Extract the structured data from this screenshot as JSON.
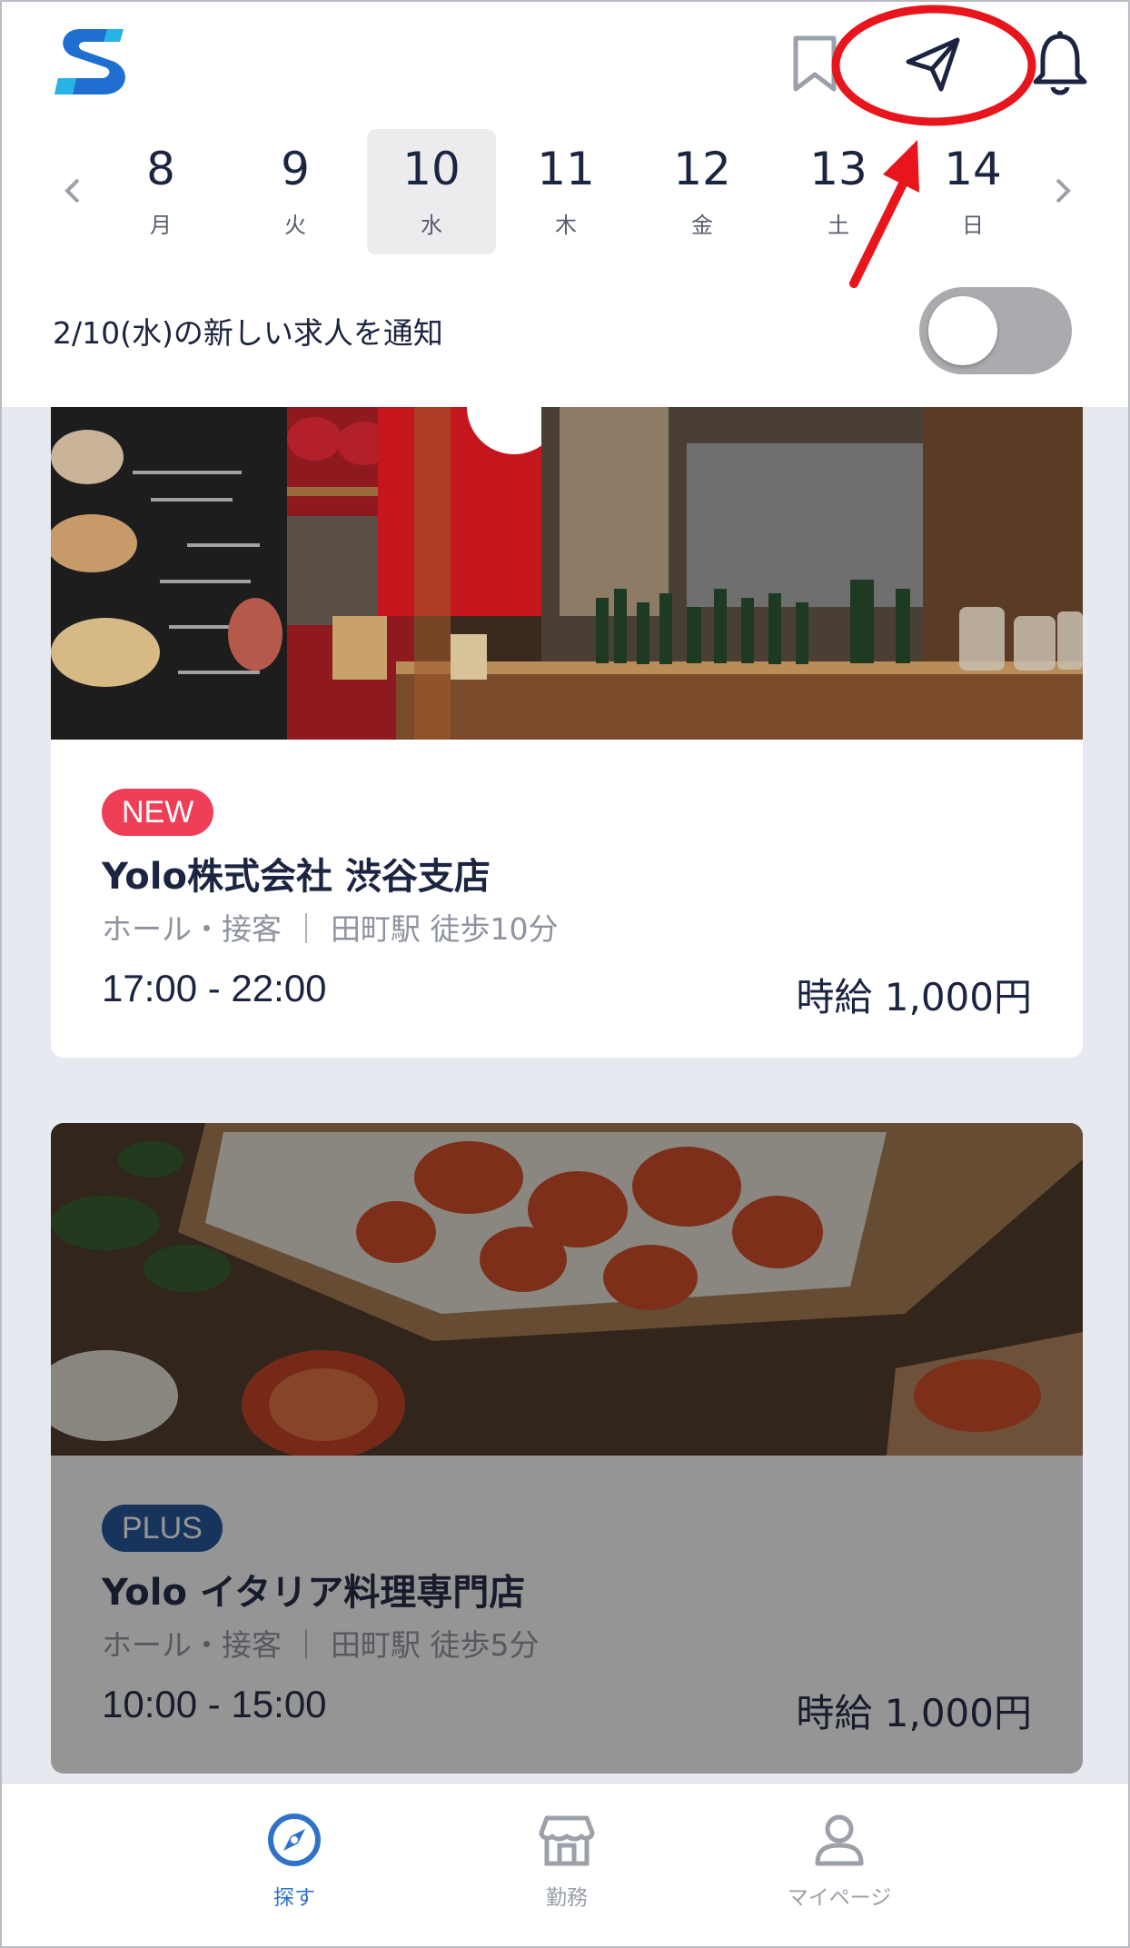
{
  "header": {
    "logo_icon": "app-logo-s",
    "icons": [
      "bookmark-icon",
      "send-icon",
      "bell-icon"
    ]
  },
  "dates": [
    {
      "num": "8",
      "weekday": "月",
      "selected": false
    },
    {
      "num": "9",
      "weekday": "火",
      "selected": false
    },
    {
      "num": "10",
      "weekday": "水",
      "selected": true
    },
    {
      "num": "11",
      "weekday": "木",
      "selected": false
    },
    {
      "num": "12",
      "weekday": "金",
      "selected": false
    },
    {
      "num": "13",
      "weekday": "土",
      "selected": false
    },
    {
      "num": "14",
      "weekday": "日",
      "selected": false
    }
  ],
  "notify": {
    "label": "2/10(水)の新しい求人を通知",
    "toggle_on": false
  },
  "jobs": [
    {
      "badge": "NEW",
      "title": "Yolo株式会社 渋谷支店",
      "subtitle": "ホール・接客 ｜ 田町駅 徒歩10分",
      "time": "17:00 - 22:00",
      "pay": "時給 1,000円",
      "badge_color": "#ee3f57"
    },
    {
      "badge": "PLUS",
      "title": "Yolo イタリア料理専門店",
      "subtitle": "ホール・接客 ｜ 田町駅 徒歩5分",
      "time": "10:00 - 15:00",
      "pay": "時給 1,000円",
      "badge_color": "#1a4f9a"
    }
  ],
  "tabs": [
    {
      "label": "探す",
      "icon": "compass-icon",
      "active": true
    },
    {
      "label": "勤務",
      "icon": "store-icon",
      "active": false
    },
    {
      "label": "マイページ",
      "icon": "person-icon",
      "active": false
    }
  ],
  "colors": {
    "accent": "#2f73c9",
    "annotation": "#e8151c",
    "text": "#1b2440"
  }
}
